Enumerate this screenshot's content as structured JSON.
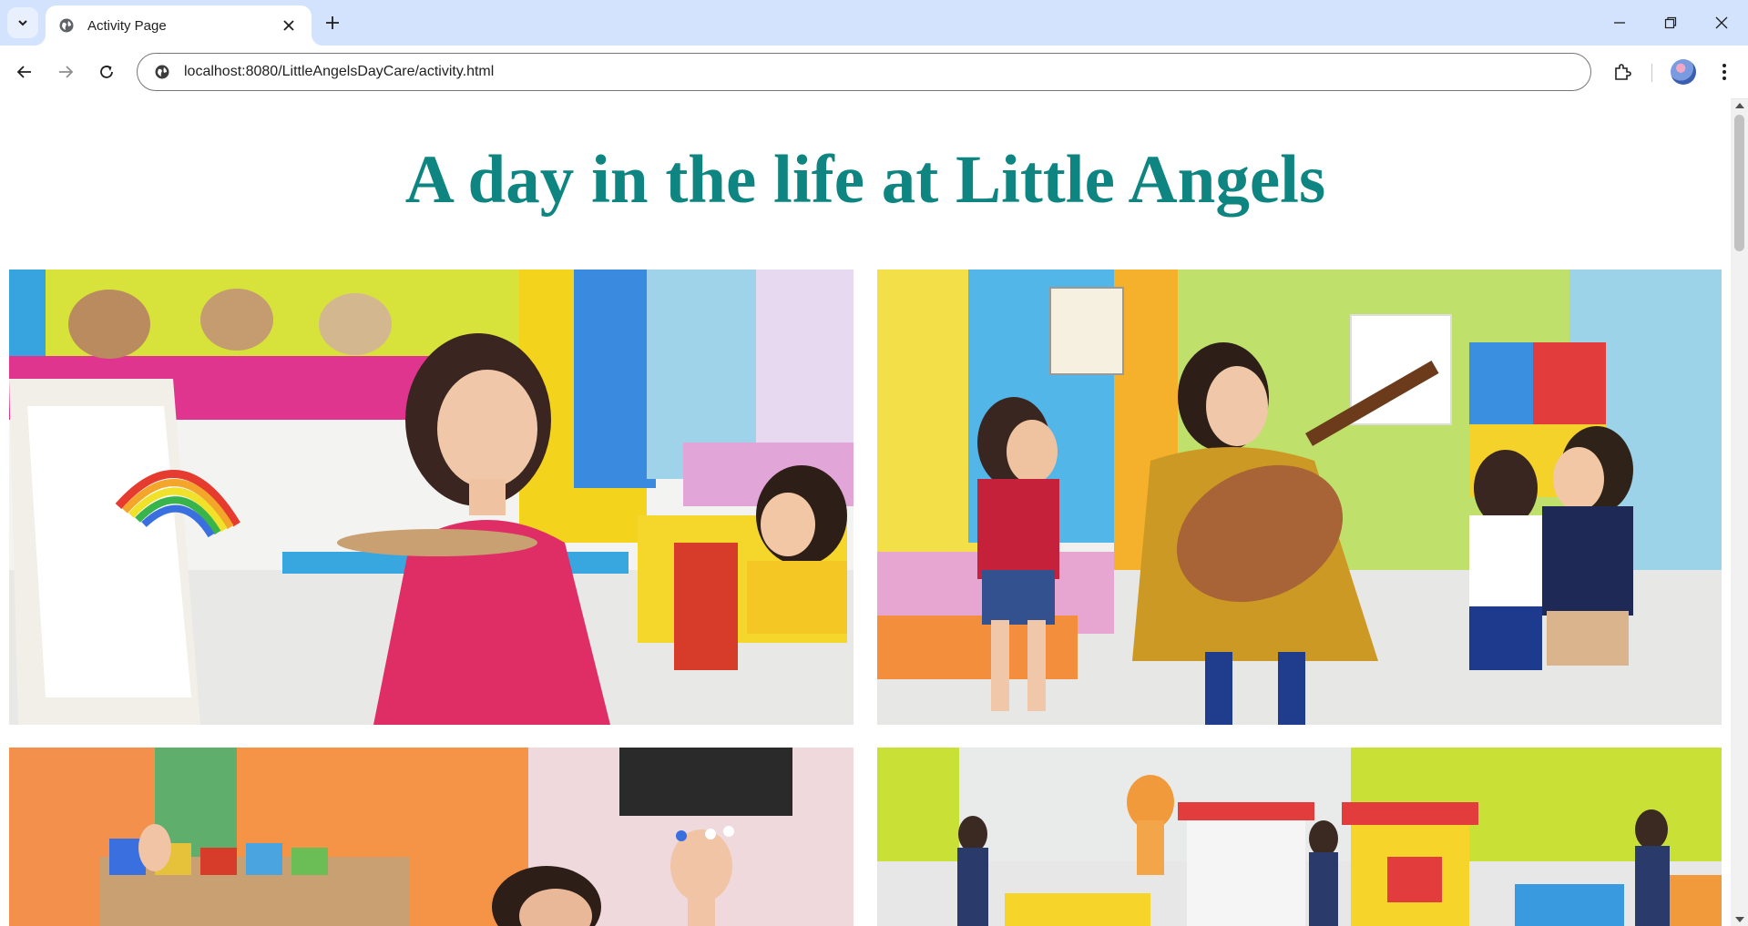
{
  "browser": {
    "tab_title": "Activity Page",
    "url": "localhost:8080/LittleAngelsDayCare/activity.html",
    "icons": {
      "tab_search": "chevron-down-icon",
      "favicon": "globe-icon",
      "tab_close": "close-icon",
      "new_tab": "plus-icon",
      "minimize": "minimize-icon",
      "restore": "restore-icon",
      "close_window": "close-icon",
      "back": "arrow-left-icon",
      "forward": "arrow-right-icon",
      "reload": "reload-icon",
      "site_info": "site-info-icon",
      "extensions": "puzzle-icon",
      "profile": "avatar",
      "menu": "kebab-menu-icon"
    },
    "colors": {
      "tabstrip": "#d3e3fd",
      "toolbar": "#ffffff"
    }
  },
  "page": {
    "heading": "A day in the life at Little Angels",
    "heading_color": "#0f8582",
    "photos": [
      {
        "subject": "girl painting a rainbow at an easel in a colorful classroom"
      },
      {
        "subject": "teacher playing guitar for clapping children"
      },
      {
        "subject": "teacher with children raising hands in a classroom"
      },
      {
        "subject": "caregivers with toddlers at an indoor play area"
      }
    ]
  }
}
